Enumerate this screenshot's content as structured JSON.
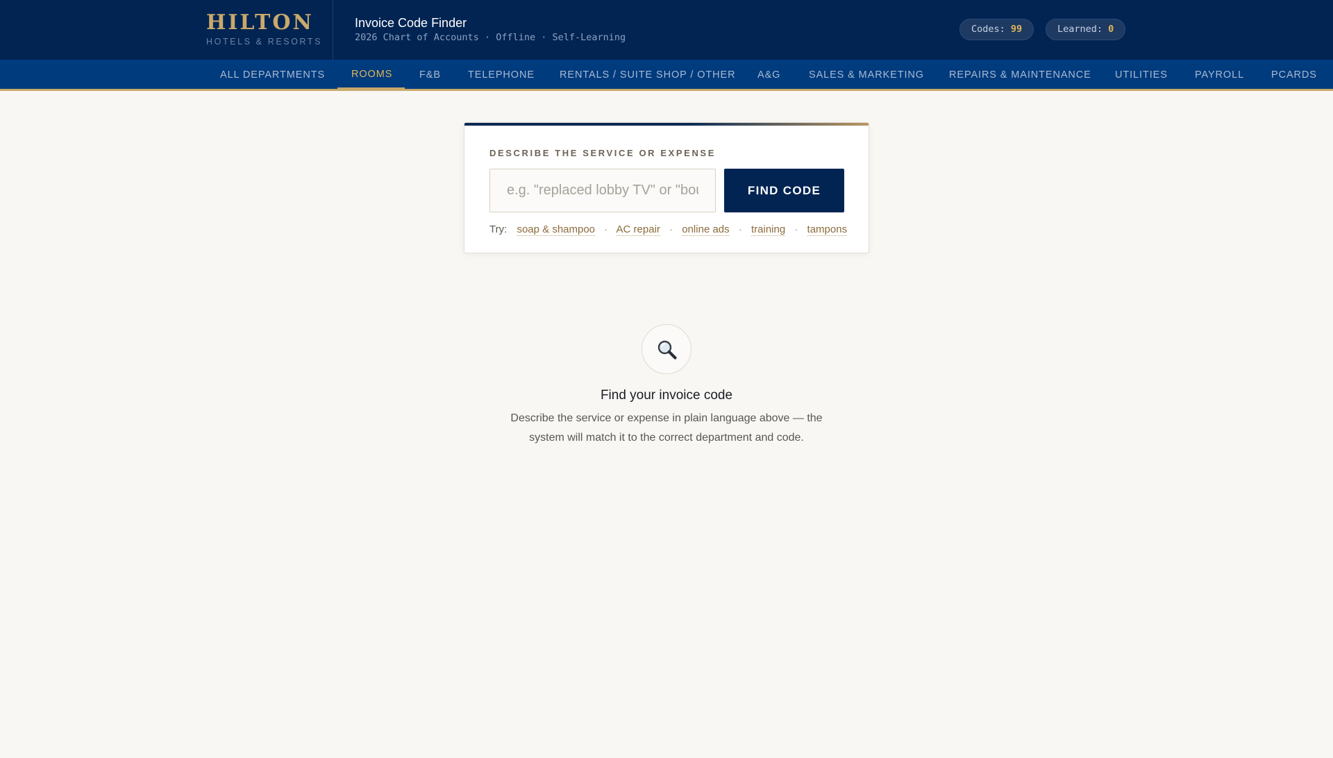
{
  "header": {
    "brand_name": "HILTON",
    "brand_sub": "HOTELS & RESORTS",
    "title": "Invoice Code Finder",
    "subtitle": "2026 Chart of Accounts · Offline · Self-Learning",
    "codes_label": "Codes:",
    "codes_value": "99",
    "learned_label": "Learned:",
    "learned_value": "0"
  },
  "nav": {
    "active": "ROOMS",
    "items": [
      "ALL DEPARTMENTS",
      "ROOMS",
      "F&B",
      "TELEPHONE",
      "RENTALS / SUITE SHOP / OTHER",
      "A&G",
      "SALES & MARKETING",
      "REPAIRS & MAINTENANCE",
      "UTILITIES",
      "PAYROLL",
      "PCARDS"
    ]
  },
  "search": {
    "label": "DESCRIBE THE SERVICE OR EXPENSE",
    "placeholder": "e.g. \"replaced lobby TV\" or \"bought printer paper\"",
    "value": "",
    "button_label": "FIND CODE",
    "try_label": "Try:",
    "suggestions": [
      "soap & shampoo",
      "AC repair",
      "online ads",
      "training",
      "tampons"
    ],
    "separator": "·"
  },
  "empty_state": {
    "icon": "magnifier-icon",
    "title": "Find your invoice code",
    "description": "Describe the service or expense in plain language above — the system will match it to the correct department and code."
  },
  "colors": {
    "header_bg": "#012453",
    "nav_bg": "#003b7d",
    "gold": "#c9a96a",
    "page_bg": "#f8f7f4"
  }
}
